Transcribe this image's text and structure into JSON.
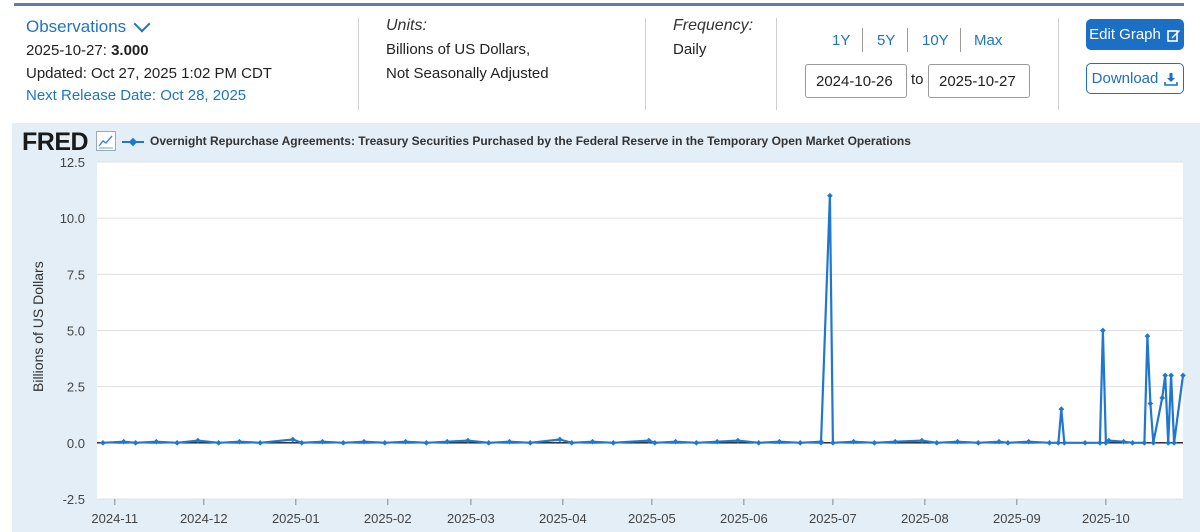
{
  "header": {
    "observations_label": "Observations",
    "obs_date": "2025-10-27:",
    "obs_value": "3.000",
    "updated": "Updated: Oct 27, 2025 1:02 PM CDT",
    "next_release": "Next Release Date: Oct 28, 2025",
    "units_label": "Units:",
    "units_line1": "Billions of US Dollars,",
    "units_line2": "Not Seasonally Adjusted",
    "frequency_label": "Frequency:",
    "frequency_value": "Daily",
    "range_buttons": [
      "1Y",
      "5Y",
      "10Y",
      "Max"
    ],
    "start_date": "2024-10-26",
    "to_label": "to",
    "end_date": "2025-10-27",
    "edit_graph": "Edit Graph",
    "download": "Download",
    "accent_color": "#1b6fc4"
  },
  "chart_data": {
    "type": "line",
    "logo": "FRED",
    "title": "Overnight Repurchase Agreements: Treasury Securities Purchased by the Federal Reserve in the Temporary Open Market Operations",
    "ylabel": "Billions of US Dollars",
    "ylim": [
      -2.5,
      12.5
    ],
    "yticks": [
      "12.5",
      "10.0",
      "7.5",
      "5.0",
      "2.5",
      "0.0",
      "-2.5"
    ],
    "xtick_labels": [
      "2024-11",
      "2024-12",
      "2025-01",
      "2025-02",
      "2025-03",
      "2025-04",
      "2025-05",
      "2025-06",
      "2025-07",
      "2025-08",
      "2025-09",
      "2025-10"
    ],
    "xtick_dates": [
      "2024-11-01",
      "2024-12-01",
      "2025-01-01",
      "2025-02-01",
      "2025-03-01",
      "2025-04-01",
      "2025-05-01",
      "2025-06-01",
      "2025-07-01",
      "2025-08-01",
      "2025-09-01",
      "2025-10-01"
    ],
    "xlim": [
      "2024-10-26",
      "2025-10-27"
    ],
    "series": [
      {
        "name": "Overnight Repurchase Agreements: Treasury Securities Purchased by the Federal Reserve in the Temporary Open Market Operations",
        "color": "#1f77d0",
        "points": [
          [
            "2024-10-28",
            0.0
          ],
          [
            "2024-11-04",
            0.05
          ],
          [
            "2024-11-08",
            0.0
          ],
          [
            "2024-11-15",
            0.05
          ],
          [
            "2024-11-22",
            0.0
          ],
          [
            "2024-11-29",
            0.1
          ],
          [
            "2024-12-06",
            0.0
          ],
          [
            "2024-12-13",
            0.05
          ],
          [
            "2024-12-20",
            0.0
          ],
          [
            "2024-12-31",
            0.15
          ],
          [
            "2025-01-03",
            0.0
          ],
          [
            "2025-01-10",
            0.05
          ],
          [
            "2025-01-17",
            0.0
          ],
          [
            "2025-01-24",
            0.05
          ],
          [
            "2025-01-31",
            0.0
          ],
          [
            "2025-02-07",
            0.05
          ],
          [
            "2025-02-14",
            0.0
          ],
          [
            "2025-02-21",
            0.05
          ],
          [
            "2025-02-28",
            0.1
          ],
          [
            "2025-03-07",
            0.0
          ],
          [
            "2025-03-14",
            0.05
          ],
          [
            "2025-03-21",
            0.0
          ],
          [
            "2025-03-31",
            0.15
          ],
          [
            "2025-04-04",
            0.0
          ],
          [
            "2025-04-11",
            0.05
          ],
          [
            "2025-04-18",
            0.0
          ],
          [
            "2025-04-30",
            0.1
          ],
          [
            "2025-05-02",
            0.0
          ],
          [
            "2025-05-09",
            0.05
          ],
          [
            "2025-05-16",
            0.0
          ],
          [
            "2025-05-23",
            0.05
          ],
          [
            "2025-05-30",
            0.1
          ],
          [
            "2025-06-06",
            0.0
          ],
          [
            "2025-06-13",
            0.05
          ],
          [
            "2025-06-20",
            0.0
          ],
          [
            "2025-06-27",
            0.05
          ],
          [
            "2025-06-27",
            0.0
          ],
          [
            "2025-06-30",
            11.0
          ],
          [
            "2025-07-01",
            0.0
          ],
          [
            "2025-07-08",
            0.05
          ],
          [
            "2025-07-15",
            0.0
          ],
          [
            "2025-07-22",
            0.05
          ],
          [
            "2025-07-31",
            0.1
          ],
          [
            "2025-08-05",
            0.0
          ],
          [
            "2025-08-12",
            0.05
          ],
          [
            "2025-08-19",
            0.0
          ],
          [
            "2025-08-26",
            0.05
          ],
          [
            "2025-08-29",
            0.0
          ],
          [
            "2025-09-05",
            0.05
          ],
          [
            "2025-09-12",
            0.0
          ],
          [
            "2025-09-15",
            0.0
          ],
          [
            "2025-09-16",
            1.5
          ],
          [
            "2025-09-17",
            0.0
          ],
          [
            "2025-09-24",
            0.0
          ],
          [
            "2025-09-29",
            0.0
          ],
          [
            "2025-09-30",
            5.0
          ],
          [
            "2025-10-01",
            0.0
          ],
          [
            "2025-10-02",
            0.1
          ],
          [
            "2025-10-07",
            0.05
          ],
          [
            "2025-10-10",
            0.0
          ],
          [
            "2025-10-14",
            0.0
          ],
          [
            "2025-10-15",
            4.75
          ],
          [
            "2025-10-16",
            1.75
          ],
          [
            "2025-10-17",
            0.0
          ],
          [
            "2025-10-20",
            2.0
          ],
          [
            "2025-10-21",
            3.0
          ],
          [
            "2025-10-22",
            0.0
          ],
          [
            "2025-10-23",
            3.0
          ],
          [
            "2025-10-24",
            0.0
          ],
          [
            "2025-10-27",
            3.0
          ]
        ]
      }
    ],
    "grid": "horizontal",
    "zero_line": true
  }
}
